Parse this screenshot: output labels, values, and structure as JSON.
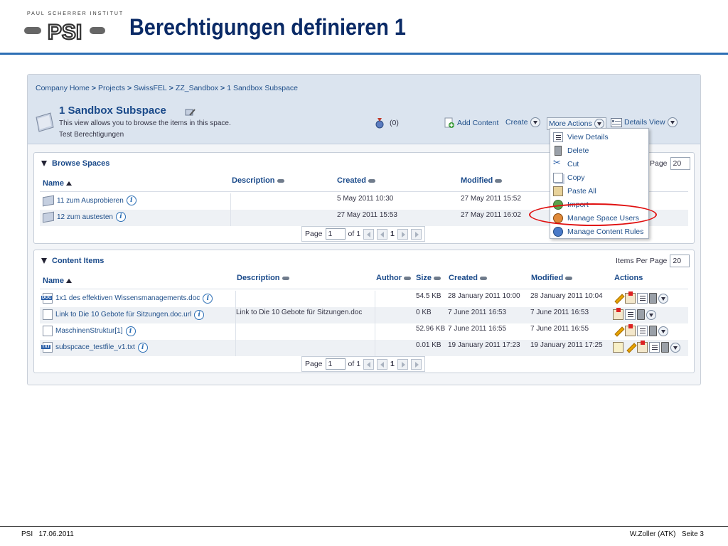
{
  "slide": {
    "logo_text": "PAUL SCHERRER INSTITUT",
    "logo_mark": "PSI",
    "title": "Berechtigungen definieren 1",
    "footer_left_org": "PSI",
    "footer_left_date": "17.06.2011",
    "footer_right_author": "W.Zoller (ATK)",
    "footer_right_page": "Seite 3"
  },
  "colors": {
    "title": "#0a2a66",
    "accent_rule": "#2d6fb5",
    "link": "#1f4f8a",
    "highlight_ring": "#e01010"
  },
  "breadcrumb": [
    "Company Home",
    "Projects",
    "SwissFEL",
    "ZZ_Sandbox",
    "1 Sandbox Subspace"
  ],
  "breadcrumb_sep": ">",
  "space": {
    "title": "1 Sandbox Subspace",
    "description": "This view allows you to browse the items in this space.",
    "subtitle": "Test Berechtigungen",
    "workflow_count": "(0)",
    "add_content": "Add Content",
    "create": "Create",
    "more_actions": "More Actions",
    "details_view": "Details View"
  },
  "more_actions_menu": [
    {
      "label": "View Details",
      "icon": "details-icon"
    },
    {
      "label": "Delete",
      "icon": "trash-icon"
    },
    {
      "label": "Cut",
      "icon": "scissors-icon"
    },
    {
      "label": "Copy",
      "icon": "copy-icon"
    },
    {
      "label": "Paste All",
      "icon": "paste-icon"
    },
    {
      "label": "Import",
      "icon": "import-icon"
    },
    {
      "label": "Manage Space Users",
      "icon": "users-icon",
      "highlighted": true
    },
    {
      "label": "Manage Content Rules",
      "icon": "rules-icon"
    }
  ],
  "browse_spaces": {
    "title": "Browse Spaces",
    "items_per_page_label": "Page",
    "items_per_page": "20",
    "columns": [
      "Name",
      "Description",
      "Created",
      "Modified"
    ],
    "rows": [
      {
        "name": "11 zum Ausprobieren",
        "description": "",
        "created": "5 May 2011 10:30",
        "modified": "27 May 2011 15:52"
      },
      {
        "name": "12 zum austesten",
        "description": "",
        "created": "27 May 2011 15:53",
        "modified": "27 May 2011 16:02"
      }
    ],
    "pager": {
      "label": "Page",
      "value": "1",
      "of": "of 1",
      "current": "1"
    }
  },
  "content_items": {
    "title": "Content Items",
    "items_per_page_label": "Items Per Page",
    "items_per_page": "20",
    "columns": [
      "Name",
      "Description",
      "Author",
      "Size",
      "Created",
      "Modified",
      "Actions"
    ],
    "rows": [
      {
        "name": "1x1 des effektiven Wissensmanagements.doc",
        "type": "doc",
        "description": "",
        "size": "54.5 KB",
        "created": "28 January 2011 10:00",
        "modified": "28 January 2011 10:04"
      },
      {
        "name": "Link to Die 10 Gebote für Sitzungen.doc.url",
        "type": "link",
        "description": "Link to Die 10 Gebote für Sitzungen.doc",
        "size": "0 KB",
        "created": "7 June 2011 16:53",
        "modified": "7 June 2011 16:53"
      },
      {
        "name": "MaschinenStruktur[1]",
        "type": "file",
        "description": "",
        "size": "52.96 KB",
        "created": "7 June 2011 16:55",
        "modified": "7 June 2011 16:55"
      },
      {
        "name": "subspcace_testfile_v1.txt",
        "type": "txt",
        "description": "",
        "size": "0.01 KB",
        "created": "19 January 2011 17:23",
        "modified": "19 January 2011 17:25"
      }
    ],
    "pager": {
      "label": "Page",
      "value": "1",
      "of": "of 1",
      "current": "1"
    }
  }
}
